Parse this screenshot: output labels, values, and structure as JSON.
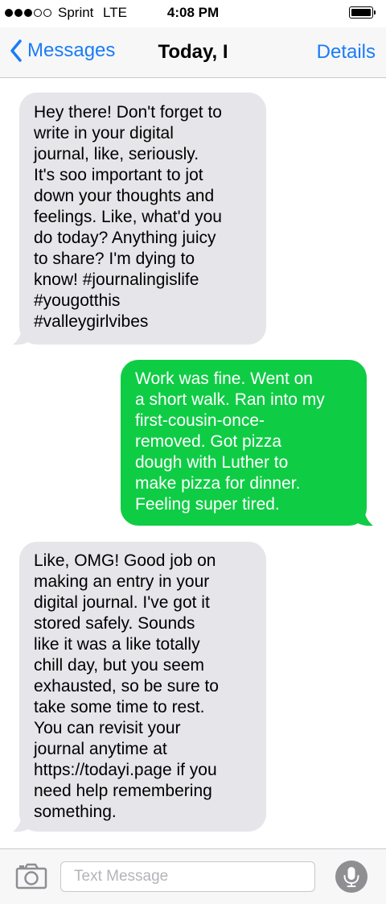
{
  "status_bar": {
    "carrier": "Sprint",
    "network": "LTE",
    "time": "4:08 PM",
    "signal_strength": 3,
    "signal_max": 5
  },
  "nav": {
    "back_label": "Messages",
    "title": "Today, I",
    "details_label": "Details",
    "accent_color": "#1a7cf6"
  },
  "messages": [
    {
      "direction": "received",
      "lines": [
        "Hey there! Don't forget to",
        "write in your digital",
        "journal, like, seriously.",
        "It's soo important to jot",
        "down your thoughts and",
        "feelings. Like, what'd you",
        "do today? Anything juicy",
        "to share? I'm dying to",
        "know! #journalingislife",
        "#yougotthis",
        "#valleygirlvibes"
      ]
    },
    {
      "direction": "sent",
      "lines": [
        "Work was fine. Went on",
        "a short walk. Ran into my",
        "first-cousin-once-",
        "removed. Got pizza",
        "dough with Luther to",
        "make pizza for dinner.",
        "Feeling super tired."
      ]
    },
    {
      "direction": "received",
      "lines": [
        "Like, OMG! Good job on",
        "making an entry in your",
        "digital journal. I've got it",
        "stored safely. Sounds",
        "like it was a like totally",
        "chill day, but you seem",
        "exhausted, so be sure to",
        "take some time to rest.",
        "You can revisit your",
        "journal anytime at",
        "https://todayi.page if you",
        "need help remembering",
        "something."
      ]
    }
  ],
  "colors": {
    "received_bubble": "#e5e5ea",
    "sent_bubble": "#0fcc45"
  },
  "input_bar": {
    "placeholder": "Text Message",
    "value": "",
    "camera_icon": "camera-icon",
    "mic_icon": "microphone-icon"
  }
}
